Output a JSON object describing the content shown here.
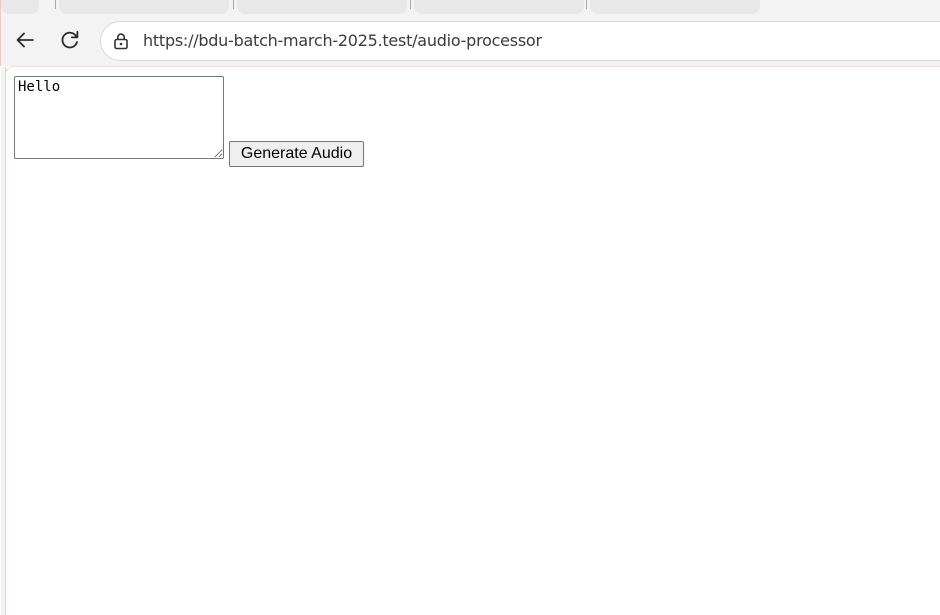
{
  "browser": {
    "address_bar": {
      "url": "https://bdu-batch-march-2025.test/audio-processor"
    },
    "icons": {
      "back": "arrow-left-icon",
      "reload": "reload-icon",
      "site_info": "lock-icon"
    },
    "colors": {
      "chrome_bg": "#f3f3f3",
      "tab_inactive": "#e8e8e8"
    }
  },
  "page": {
    "text_input": {
      "value": "Hello"
    },
    "generate_button": {
      "label": "Generate Audio"
    }
  }
}
